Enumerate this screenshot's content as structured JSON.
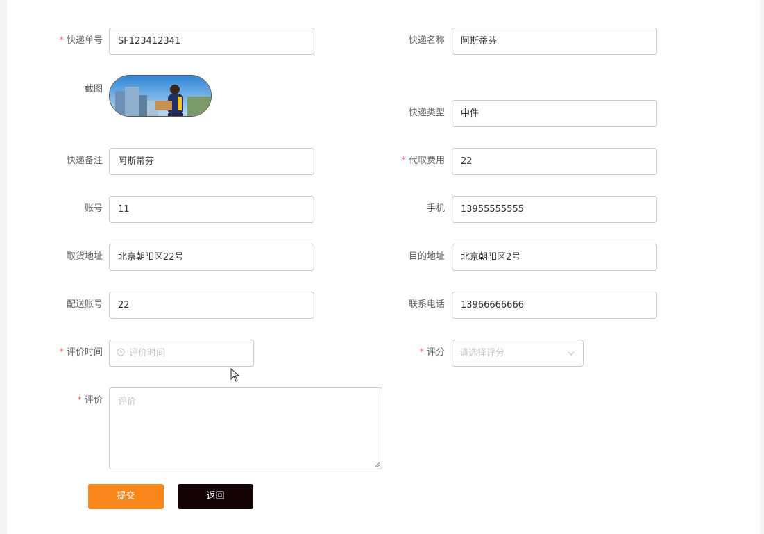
{
  "form": {
    "tracking_no": {
      "label": "快递单号",
      "value": "SF123412341",
      "required": true
    },
    "courier_name": {
      "label": "快递名称",
      "value": "阿斯蒂芬"
    },
    "screenshot": {
      "label": "截图"
    },
    "courier_type": {
      "label": "快递类型",
      "value": "中件"
    },
    "remark": {
      "label": "快递备注",
      "value": "阿斯蒂芬"
    },
    "fee": {
      "label": "代取费用",
      "value": "22",
      "required": true
    },
    "account": {
      "label": "账号",
      "value": "11"
    },
    "phone": {
      "label": "手机",
      "value": "13955555555"
    },
    "pickup_address": {
      "label": "取货地址",
      "value": "北京朝阳区22号"
    },
    "destination": {
      "label": "目的地址",
      "value": "北京朝阳区2号"
    },
    "delivery_account": {
      "label": "配送账号",
      "value": "22"
    },
    "contact_phone": {
      "label": "联系电话",
      "value": "13966666666"
    },
    "review_time": {
      "label": "评价时间",
      "placeholder": "评价时间",
      "required": true
    },
    "rating": {
      "label": "评分",
      "placeholder": "请选择评分",
      "required": true
    },
    "review": {
      "label": "评价",
      "placeholder": "评价",
      "required": true
    }
  },
  "buttons": {
    "submit": "提交",
    "back": "返回"
  },
  "colors": {
    "submit_bg": "#f7861b",
    "back_bg": "#140406",
    "required_mark": "#f56c6c"
  },
  "icons": {
    "time": "clock-icon",
    "select": "chevron-down-icon",
    "cursor": "mouse-pointer-icon"
  }
}
